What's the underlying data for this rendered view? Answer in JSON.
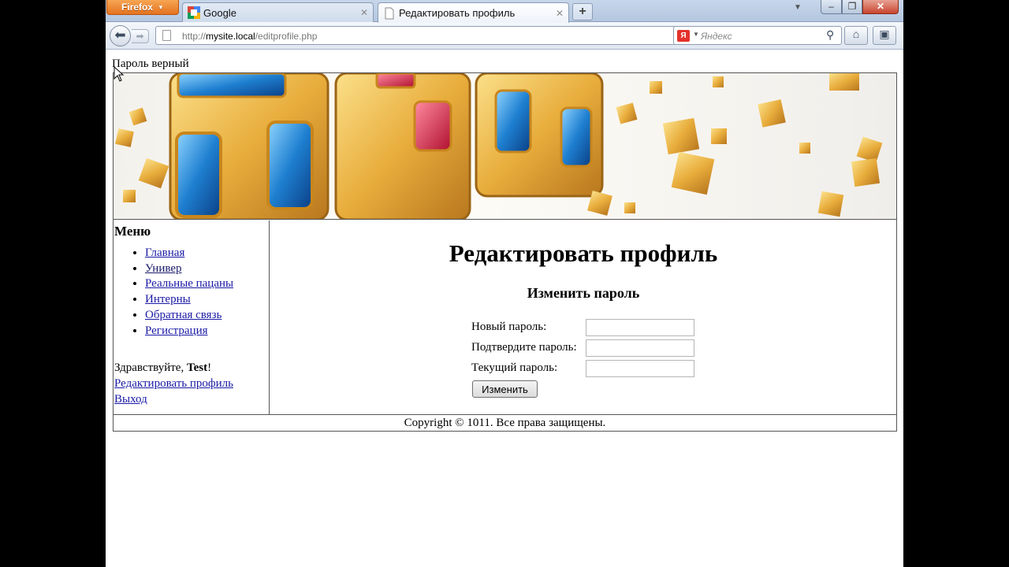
{
  "browser": {
    "app_menu_label": "Firefox",
    "tabs": [
      {
        "title": "Google"
      },
      {
        "title": "Редактировать профиль"
      }
    ],
    "url_prefix": "http://",
    "url_host": "mysite.local",
    "url_path": "/editprofile.php",
    "search_placeholder": "Яндекс",
    "search_engine_label": "Я"
  },
  "page": {
    "status_message": "Пароль верный",
    "menu": {
      "title": "Меню",
      "items": [
        {
          "label": "Главная"
        },
        {
          "label": "Универ"
        },
        {
          "label": "Реальные пацаны"
        },
        {
          "label": "Интерны"
        },
        {
          "label": "Обратная связь"
        },
        {
          "label": "Регистрация"
        }
      ]
    },
    "greeting": {
      "prefix": "Здравствуйте, ",
      "username": "Test",
      "suffix": "!"
    },
    "edit_profile_link": "Редактировать профиль",
    "logout_link": "Выход",
    "title": "Редактировать профиль",
    "form": {
      "heading": "Изменить пароль",
      "new_password_label": "Новый пароль:",
      "confirm_password_label": "Подтвердите пароль:",
      "current_password_label": "Текущий пароль:",
      "submit_label": "Изменить"
    },
    "footer": "Copyright © 1011. Все права защищены."
  },
  "colors": {
    "link": "#1a1aa6",
    "firefox_button": "#e5731f",
    "close_button": "#c8452e"
  }
}
